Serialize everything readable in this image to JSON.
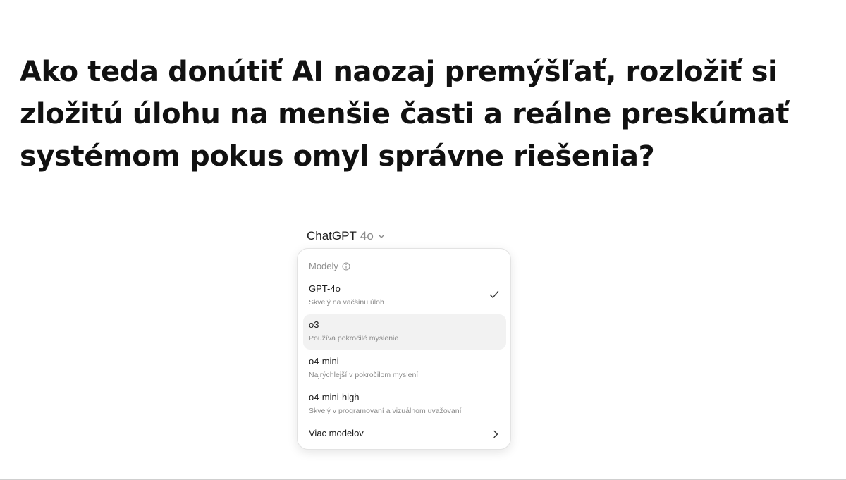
{
  "headline": "Ako teda donútiť AI naozaj premýšľať, rozložiť si zložitú úlohu na menšie časti a reálne preskúmať systémom pokus omyl správne riešenia?",
  "model_switcher": {
    "app_name": "ChatGPT",
    "version": "4o",
    "icon": "chevron-down-icon"
  },
  "menu": {
    "header": "Modely",
    "header_icon": "info-icon",
    "items": [
      {
        "name": "GPT-4o",
        "description": "Skvelý na väčšinu úloh",
        "selected": true
      },
      {
        "name": "o3",
        "description": "Používa pokročilé myslenie",
        "highlighted": true
      },
      {
        "name": "o4-mini",
        "description": "Najrýchlejší v pokročilom myslení"
      },
      {
        "name": "o4-mini-high",
        "description": "Skvelý v programovaní a vizuálnom uvažovaní"
      }
    ],
    "more_label": "Viac modelov",
    "more_icon": "chevron-right-icon"
  },
  "colors": {
    "highlight_bg": "#f2f2f2",
    "border": "#e3e3e3",
    "muted_text": "#8a8a8a"
  }
}
